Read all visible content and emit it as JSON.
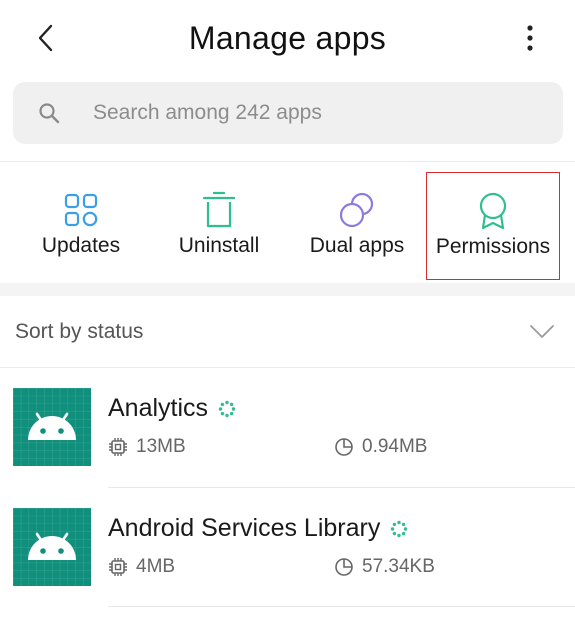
{
  "header": {
    "title": "Manage apps",
    "back_icon": "chevron-left-icon",
    "more_icon": "more-vertical-icon"
  },
  "search": {
    "placeholder": "Search among 242 apps",
    "value": "",
    "icon": "search-icon"
  },
  "toolbar": {
    "items": [
      {
        "label": "Updates",
        "icon": "grid-icon",
        "color": "#3b9fe8"
      },
      {
        "label": "Uninstall",
        "icon": "trash-icon",
        "color": "#2fbf8f"
      },
      {
        "label": "Dual apps",
        "icon": "dual-circles-icon",
        "color": "#8a7be0"
      },
      {
        "label": "Permissions",
        "icon": "badge-icon",
        "color": "#2fbf8f",
        "selected": true
      }
    ]
  },
  "sort": {
    "label": "Sort by status",
    "icon": "chevron-down-icon"
  },
  "apps": [
    {
      "name": "Analytics",
      "storage": "13MB",
      "cache": "0.94MB",
      "icon": "android-icon"
    },
    {
      "name": "Android Services Library",
      "storage": "4MB",
      "cache": "57.34KB",
      "icon": "android-icon"
    }
  ],
  "colors": {
    "accent_blue": "#3b9fe8",
    "accent_green": "#2fbf8f",
    "accent_purple": "#8a7be0",
    "selection_border": "#d32f2f",
    "app_icon_bg": "#0f8f7c"
  }
}
